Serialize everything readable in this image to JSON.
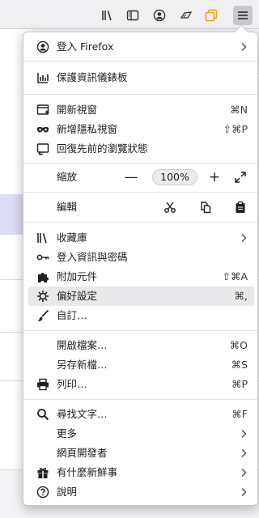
{
  "toolbar": {
    "buttons": [
      "library-icon",
      "sidebar-icon",
      "account-icon",
      "screenshot-icon",
      "containers-icon",
      "menu-icon"
    ]
  },
  "menu": {
    "sign_in": {
      "label": "登入 Firefox"
    },
    "protections": {
      "label": "保護資訊儀錶板"
    },
    "new_window": {
      "label": "開新視窗",
      "shortcut": "⌘N"
    },
    "private_window": {
      "label": "新增隱私視窗",
      "shortcut": "⇧⌘P"
    },
    "restore_session": {
      "label": "回復先前的瀏覽狀態"
    },
    "zoom": {
      "label": "縮放",
      "value": "100%",
      "minus": "—",
      "plus": "+"
    },
    "edit": {
      "label": "編輯"
    },
    "library": {
      "label": "收藏庫"
    },
    "logins": {
      "label": "登入資訊與密碼"
    },
    "addons": {
      "label": "附加元件",
      "shortcut": "⇧⌘A"
    },
    "preferences": {
      "label": "偏好設定",
      "shortcut": "⌘,"
    },
    "customize": {
      "label": "自訂…"
    },
    "open_file": {
      "label": "開啟檔案…",
      "shortcut": "⌘O"
    },
    "save_as": {
      "label": "另存新檔…",
      "shortcut": "⌘S"
    },
    "print": {
      "label": "列印…",
      "shortcut": "⌘P"
    },
    "find": {
      "label": "尋找文字…",
      "shortcut": "⌘F"
    },
    "more": {
      "label": "更多"
    },
    "web_developer": {
      "label": "網頁開發者"
    },
    "whats_new": {
      "label": "有什麼新鮮事"
    },
    "help": {
      "label": "說明"
    }
  },
  "colors": {
    "accent_orange": "#e8a21a",
    "hover_bg": "#e8e8ea",
    "menu_border": "#c9c9cc"
  }
}
